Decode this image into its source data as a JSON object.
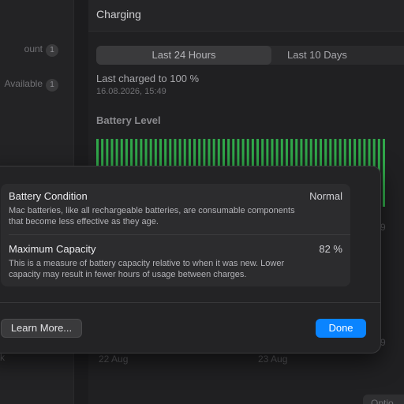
{
  "sidebar": {
    "items": [
      {
        "label": "ount",
        "count": "1"
      },
      {
        "label": "Available",
        "count": "1"
      }
    ],
    "back_label": "ck"
  },
  "charging": {
    "title": "Charging"
  },
  "segment": {
    "active": "Last 24 Hours",
    "other": "Last 10 Days"
  },
  "last_charged": {
    "label": "Last charged to 100 %",
    "time": "16.08.2026, 15:49"
  },
  "battery_level": {
    "title": "Battery Level",
    "color": "#30a84a"
  },
  "bg_labels": {
    "axis_right_1": "9",
    "axis_right_2": "9",
    "date_1": "22 Aug",
    "date_2": "23 Aug"
  },
  "options_label": "Optio",
  "sheet": {
    "condition": {
      "title": "Battery Condition",
      "value": "Normal",
      "description": "Mac batteries, like all rechargeable batteries, are consumable components that become less effective as they age."
    },
    "capacity": {
      "title": "Maximum Capacity",
      "value": "82 %",
      "description": "This is a measure of battery capacity relative to when it was new. Lower capacity may result in fewer hours of usage between charges."
    },
    "learn_more_label": "Learn More...",
    "done_label": "Done",
    "accent": "#0a84ff"
  }
}
